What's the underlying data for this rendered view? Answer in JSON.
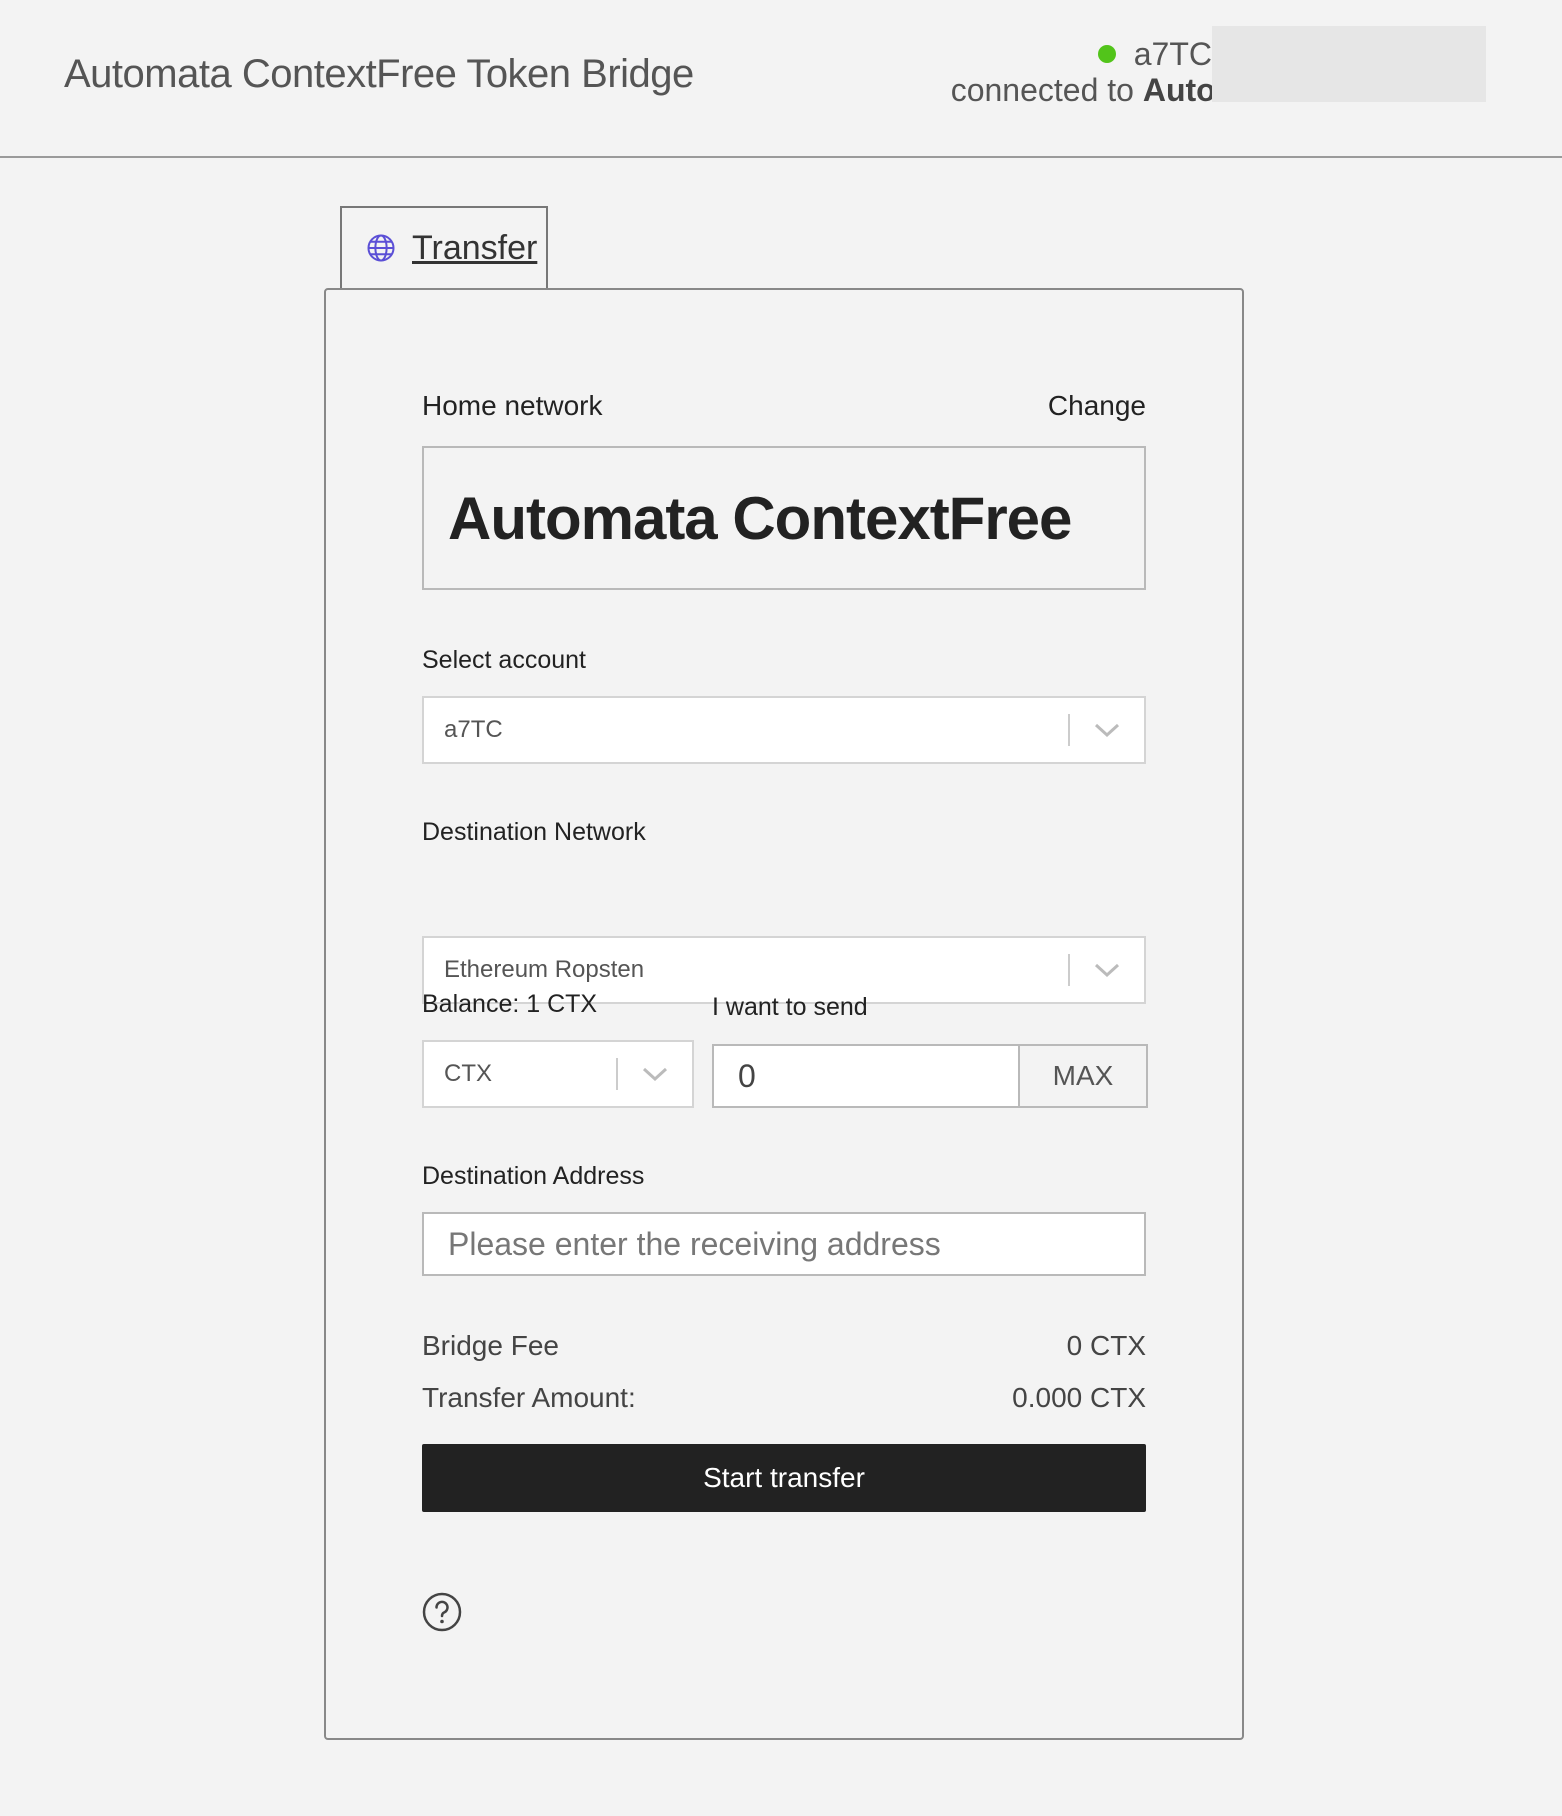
{
  "header": {
    "title": "Automata ContextFree Token Bridge",
    "account_name": "a7TC",
    "connected_prefix": "connected to",
    "connected_network": "Automata ContextFree",
    "status_color": "#52c41a"
  },
  "tab": {
    "label": "Transfer",
    "icon": "globe-icon"
  },
  "form": {
    "home_network_label": "Home network",
    "change_label": "Change",
    "home_network_value": "Automata ContextFree",
    "select_account_label": "Select account",
    "select_account_value": "a7TC",
    "destination_network_label": "Destination Network",
    "destination_network_value": "Ethereum Ropsten",
    "balance_label": "Balance: 1 CTX",
    "want_to_send_label": "I want to send",
    "token_value": "CTX",
    "amount_value": "0",
    "max_label": "MAX",
    "destination_address_label": "Destination Address",
    "destination_address_placeholder": "Please enter the receiving address",
    "bridge_fee_label": "Bridge Fee",
    "bridge_fee_value": "0 CTX",
    "transfer_amount_label": "Transfer Amount:",
    "transfer_amount_value": "0.000 CTX",
    "start_button": "Start transfer",
    "help_icon": "question-circle-icon"
  }
}
